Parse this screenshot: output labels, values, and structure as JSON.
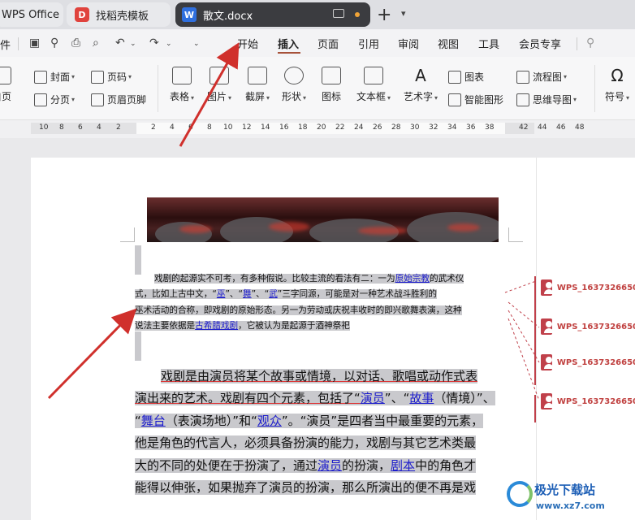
{
  "tabs": {
    "wps": "WPS Office",
    "template": "找稻壳模板",
    "document": "散文.docx"
  },
  "menu": {
    "file": "件",
    "items": [
      "开始",
      "插入",
      "页面",
      "引用",
      "审阅",
      "视图",
      "工具",
      "会员专享"
    ]
  },
  "ribbon": {
    "cover": "封面",
    "page_num": "页码",
    "page_break": "分页",
    "header_footer": "页眉页脚",
    "left_cut": "白页",
    "table": "表格",
    "image": "图片",
    "screenshot": "截屏",
    "shape": "形状",
    "icon": "图标",
    "textbox": "文本框",
    "wordart": "艺术字",
    "chart": "图表",
    "smart_shape": "智能图形",
    "flowchart": "流程图",
    "mindmap": "思维导图",
    "symbol": "符号"
  },
  "ruler": {
    "left": [
      "10",
      "8",
      "6",
      "4",
      "2"
    ],
    "right": [
      "2",
      "4",
      "6",
      "8",
      "10",
      "12",
      "14",
      "16",
      "18",
      "20",
      "22",
      "24",
      "26",
      "28",
      "30",
      "32",
      "34",
      "36",
      "38",
      "42",
      "44",
      "46",
      "48"
    ]
  },
  "small_para": {
    "l1a": "戏剧的起源实不可考，有多种假说。比较主流的看法有二：一为",
    "l1b": "原始宗教",
    "l1c": "的武术仪",
    "l2a": "式，比如上古中文，“",
    "l2b": "巫",
    "l2c": "”、“",
    "l2d": "舞",
    "l2e": "”、“",
    "l2f": "武",
    "l2g": "”三字同源，可能是对一种艺术战斗胜利的",
    "l3": "巫术活动的合称，即戏剧的原始形态。另一为劳动或庆祝丰收时的即兴歌舞表演，这种",
    "l4a": "说法主要依据是",
    "l4b": "古希腊戏剧",
    "l4c": "，它被认为是起源于酒神祭祀"
  },
  "big_para": {
    "l1": "戏剧是由演员将某个故事或情境，以对话、歌唱或动作式表",
    "l2a": "演出来的艺术。戏剧有四个元素，包括了“",
    "l2b": "演员",
    "l2c": "”、“",
    "l2d": "故事",
    "l2e": "（情境）”、",
    "l3a": "“",
    "l3b": "舞台",
    "l3c": "（表演场地）”和“",
    "l3d": "观众",
    "l3e": "”。“演员”是四者当中最重要的元素，",
    "l4": "他是角色的代言人，必须具备扮演的能力，戏剧与其它艺术类最",
    "l5a": "大的不同的处便在于扮演了，通过",
    "l5b": "演员",
    "l5c": "的扮演，",
    "l5d": "剧本",
    "l5e": "中的角色才",
    "l6": "能得以伸张，如果抛弃了演员的扮演，那么所演出的便不再是戏"
  },
  "comments": [
    "WPS_1637326650",
    "WPS_1637326650",
    "WPS_1637326650",
    "WPS_1637326650"
  ],
  "watermark": {
    "title": "极光下载站",
    "url": "www.xz7.com"
  }
}
